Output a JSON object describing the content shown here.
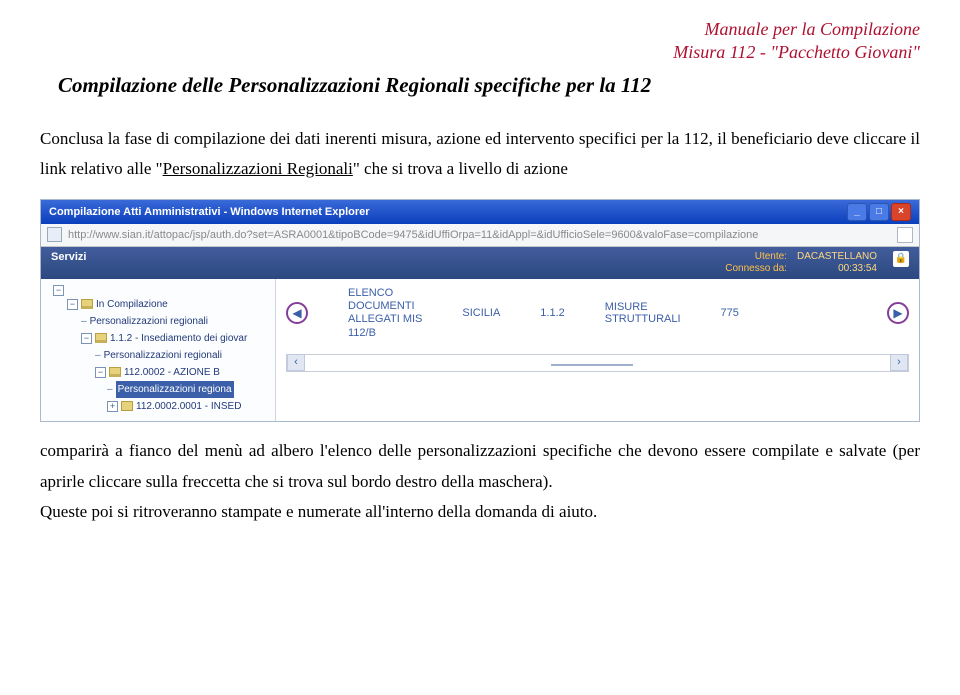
{
  "header": {
    "line1": "Manuale per la Compilazione",
    "line2": "Misura 112 - \"Pacchetto Giovani\""
  },
  "section_title": "Compilazione delle Personalizzazioni Regionali specifiche per la 112",
  "intro": {
    "p1a": "Conclusa la fase di compilazione dei dati inerenti misura, azione ed intervento specifici per la 112, il beneficiario deve cliccare il link relativo alle \"",
    "p1_link": "Personalizzazioni Regionali",
    "p1b": "\" che si trova a livello di azione"
  },
  "screenshot": {
    "window_title": "Compilazione Atti Amministrativi - Windows Internet Explorer",
    "url": "http://www.sian.it/attopac/jsp/auth.do?set=ASRA0001&tipoBCode=9475&idUffiOrpa=11&idAppl=&idUfficioSele=9600&valoFase=compilazione",
    "servizi_label": "Servizi",
    "user": {
      "utente_lbl": "Utente:",
      "utente_val": "DACASTELLANO",
      "conn_lbl": "Connesso da:",
      "conn_val": "00:33:54"
    },
    "tree": {
      "root": "In Compilazione",
      "n1": "Personalizzazioni regionali",
      "n2": "1.1.2 - Insediamento dei giovar",
      "n3": "Personalizzazioni regionali",
      "n4": "112.0002 - AZIONE B",
      "n5": "Personalizzazioni regiona",
      "n6": "112.0002.0001 - INSED"
    },
    "detail": {
      "elenco": "ELENCO\nDOCUMENTI\nALLEGATI MIS\n112/B",
      "regione": "SICILIA",
      "ver": "1.1.2",
      "misure": "MISURE\nSTRUTTURALI",
      "num": "775"
    }
  },
  "outro": {
    "p2": "comparirà a fianco del menù ad albero l'elenco delle personalizzazioni specifiche che devono essere compilate e salvate (per aprirle cliccare sulla freccetta che si trova sul bordo destro della maschera).",
    "p3": "Queste poi si ritroveranno stampate e numerate all'interno della domanda di aiuto."
  }
}
